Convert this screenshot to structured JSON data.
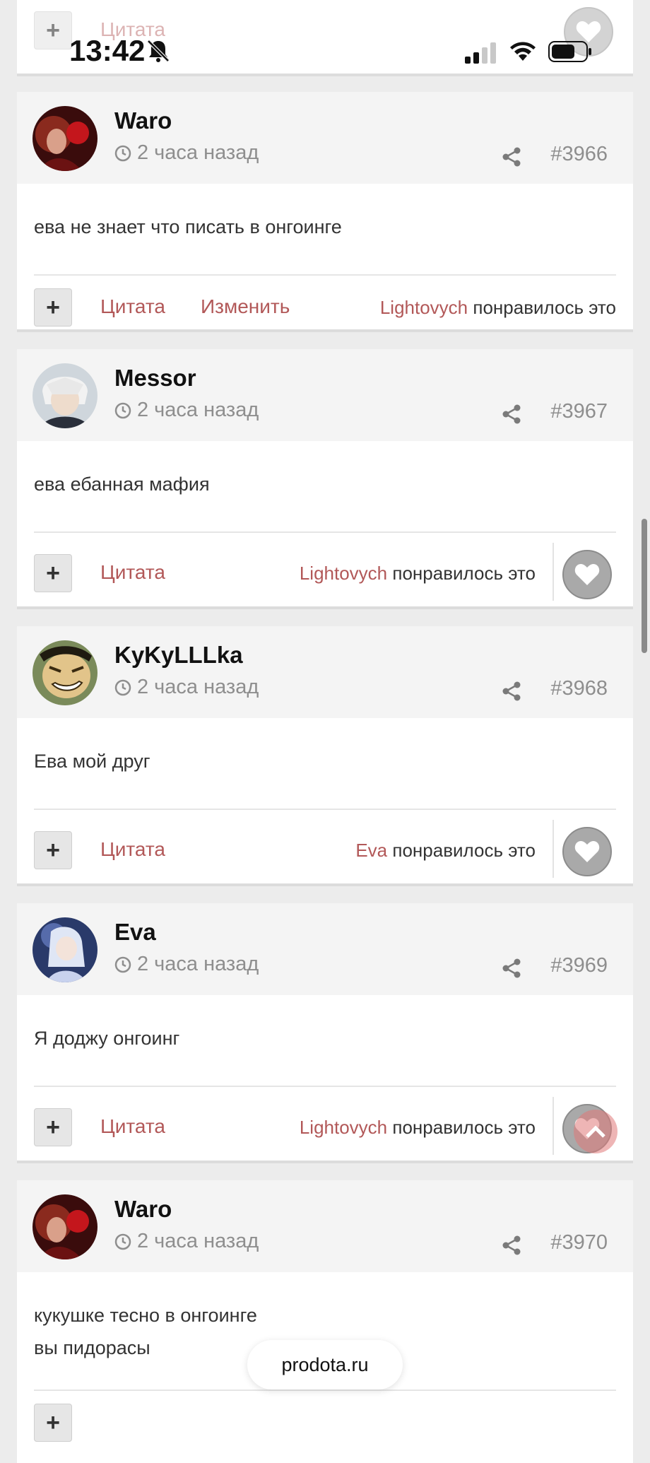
{
  "status": {
    "time": "13:42"
  },
  "top_partial": {
    "quote_label": "Цитата"
  },
  "posts": [
    {
      "username": "Waro",
      "time": "2 часа назад",
      "number": "#3966",
      "body": [
        "ева не знает что писать в онгоинге"
      ],
      "quote_label": "Цитата",
      "edit_label": "Изменить",
      "liker": "Lightovych",
      "likes_suffix": "понравилось это"
    },
    {
      "username": "Messor",
      "time": "2 часа назад",
      "number": "#3967",
      "body": [
        "ева ебанная мафия"
      ],
      "quote_label": "Цитата",
      "liker": "Lightovych",
      "likes_suffix": "понравилось это"
    },
    {
      "username": "KyKyLLLka",
      "time": "2 часа назад",
      "number": "#3968",
      "body": [
        "Ева мой друг"
      ],
      "quote_label": "Цитата",
      "liker": "Eva",
      "likes_suffix": "понравилось это"
    },
    {
      "username": "Eva",
      "time": "2 часа назад",
      "number": "#3969",
      "body": [
        "Я доджу онгоинг"
      ],
      "quote_label": "Цитата",
      "liker": "Lightovych",
      "likes_suffix": "понравилось это"
    },
    {
      "username": "Waro",
      "time": "2 часа назад",
      "number": "#3970",
      "body": [
        "кукушке тесно в онгоинге",
        "вы пидорасы"
      ]
    }
  ],
  "site_pill": "prodota.ru",
  "icons": {
    "clock": "clock-icon",
    "share": "share-icon",
    "heart": "heart-icon",
    "plus": "plus-icon",
    "bell_off": "bell-slash-icon",
    "scroll_top": "chevron-up-icon"
  },
  "colors": {
    "link": "#b25858",
    "muted": "#8e8e8e",
    "page_bg": "#ececec"
  }
}
